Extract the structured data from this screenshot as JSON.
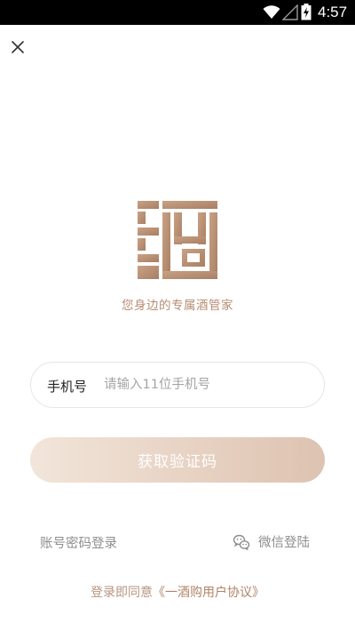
{
  "status_bar": {
    "time": "4:57"
  },
  "brand": {
    "tagline": "您身边的专属酒管家",
    "accent": "#b58d72"
  },
  "login": {
    "phone_label": "手机号",
    "phone_placeholder": "请输入11位手机号",
    "phone_value": "",
    "get_code_label": "获取验证码",
    "account_login_label": "账号密码登录",
    "wechat_login_label": "微信登陆"
  },
  "agreement": {
    "prefix": "登录即同意",
    "link": "《一酒购用户协议》"
  },
  "icons": {
    "close": "close-icon",
    "wifi": "wifi-icon",
    "signal": "cellular-signal-icon",
    "battery": "battery-charging-icon",
    "wechat": "wechat-icon",
    "logo": "jiu-logo"
  }
}
